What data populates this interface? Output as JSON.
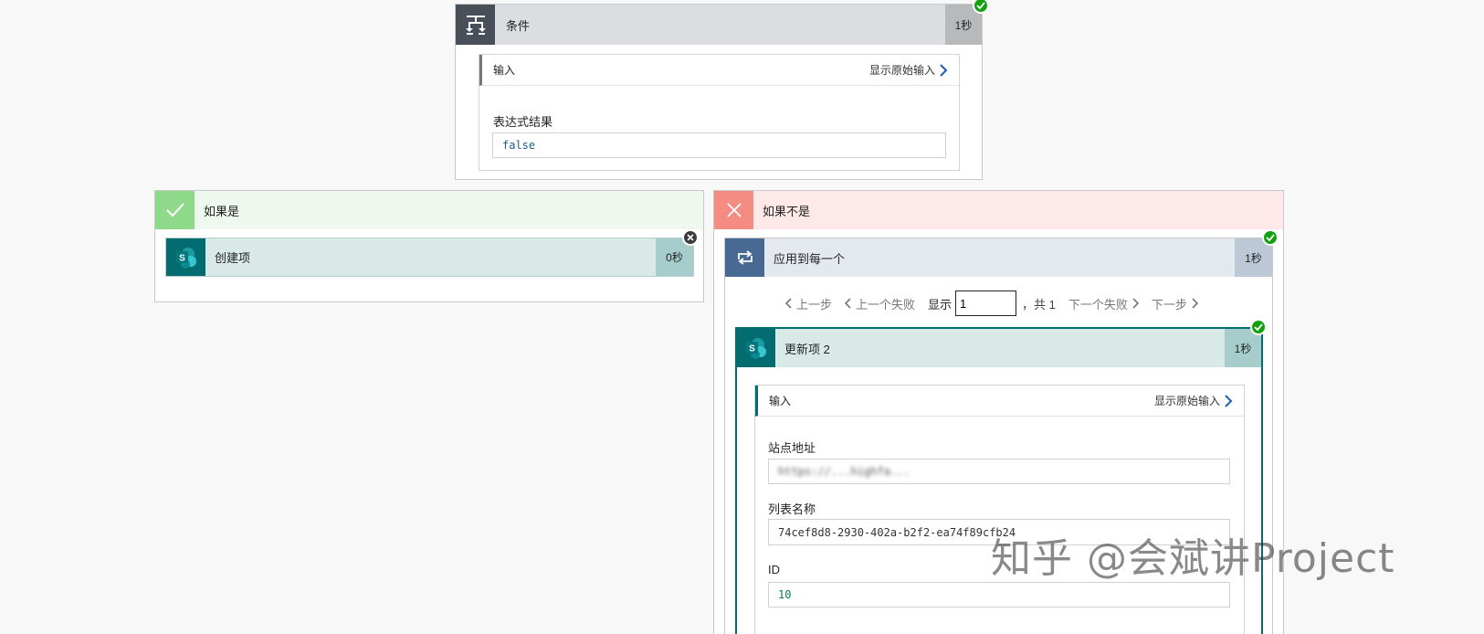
{
  "condition": {
    "title": "条件",
    "duration": "1秒",
    "inputs_label": "输入",
    "show_raw": "显示原始输入",
    "expr_label": "表达式结果",
    "expr_value": "false"
  },
  "if_yes": {
    "title": "如果是",
    "action": {
      "title": "创建项",
      "duration": "0秒"
    }
  },
  "if_no": {
    "title": "如果不是",
    "foreach": {
      "title": "应用到每一个",
      "duration": "1秒",
      "pager": {
        "prev": "上一步",
        "prev_fail": "上一个失败",
        "show": "显示",
        "current": "1",
        "total": "，共 1",
        "next_fail": "下一个失败",
        "next": "下一步"
      },
      "update": {
        "title": "更新项 2",
        "duration": "1秒",
        "inputs_label": "输入",
        "show_raw": "显示原始输入",
        "site_label": "站点地址",
        "site_value": "https://...highfa...",
        "list_label": "列表名称",
        "list_value": "74cef8d8-2930-402a-b2f2-ea74f89cfb24",
        "id_label": "ID",
        "id_value": "10"
      }
    }
  },
  "watermark": "知乎 @会斌讲Project",
  "colors": {
    "condition_icon_bg": "#484f58",
    "yes_accent": "#8fd98b",
    "no_accent": "#f58c84",
    "sharepoint_bg": "#036c70",
    "foreach_icon_bg": "#486991",
    "success": "#13a10e"
  }
}
